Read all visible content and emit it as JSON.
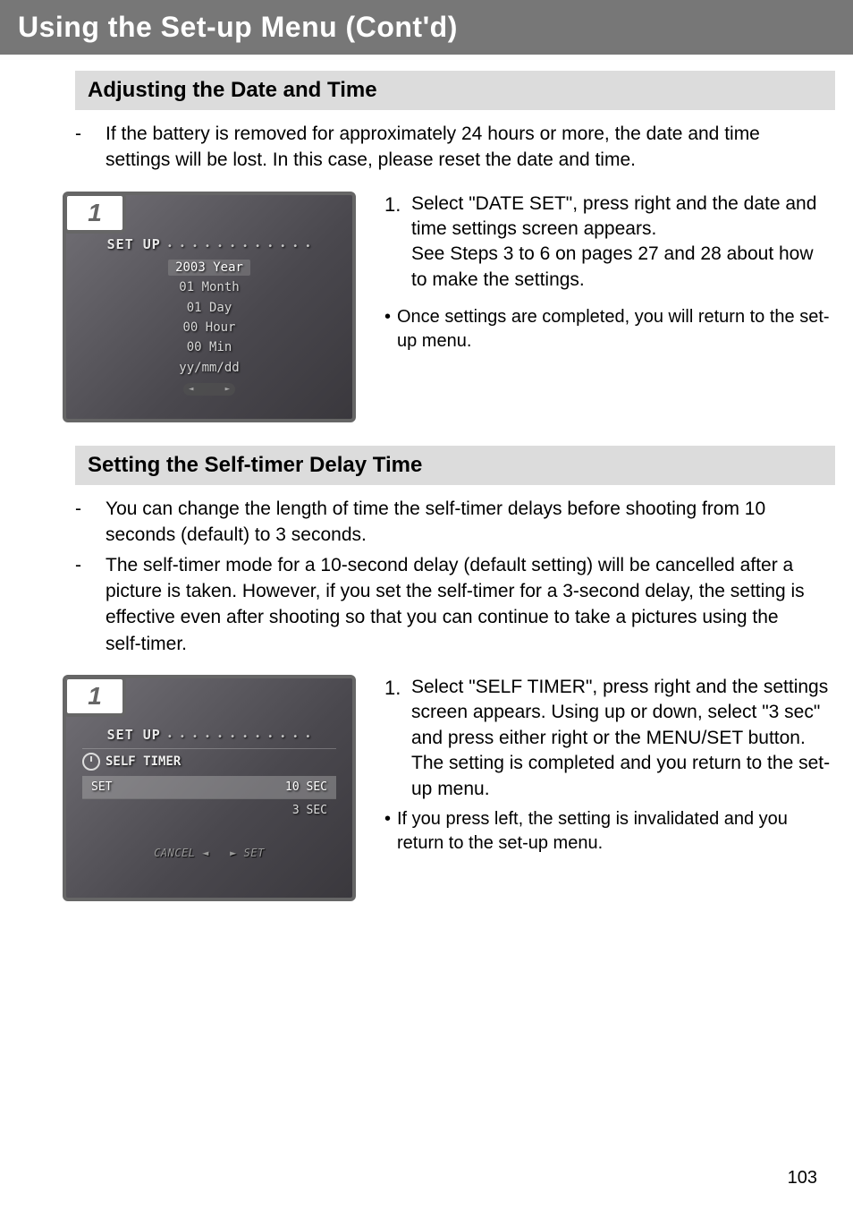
{
  "page_title": "Using the Set-up Menu (Cont'd)",
  "page_number": "103",
  "section1": {
    "heading": "Adjusting the Date and Time",
    "bullets": [
      "If the battery is removed for approximately 24 hours or more, the date and time settings will be lost.  In this case, please reset the date and time."
    ],
    "screenshot": {
      "badge": "1",
      "title": "SET UP",
      "items": [
        "2003 Year",
        "01 Month",
        "01 Day",
        "00 Hour",
        "00 Min",
        "yy/mm/dd"
      ]
    },
    "step": {
      "num": "1.",
      "text1": "Select \"DATE SET\", press right and the date and time settings screen appears.",
      "text2": "See Steps 3 to 6 on pages 27 and 28 about how to make the settings."
    },
    "sub_bullet": "Once settings are completed, you will return to the set-up menu."
  },
  "section2": {
    "heading": "Setting the Self-timer Delay Time",
    "bullets": [
      "You can change the length of time the self-timer delays before shooting from 10 seconds (default) to 3 seconds.",
      "The self-timer mode for a 10-second delay (default setting) will be cancelled after a picture is taken. However, if you set the self-timer for a 3-second delay, the setting is effective even after shooting so that you can continue to take a pictures using the self-timer."
    ],
    "screenshot": {
      "badge": "1",
      "title": "SET UP",
      "subtitle": "SELF TIMER",
      "row_label": "SET",
      "options": [
        "10 SEC",
        "3 SEC"
      ],
      "footer_left": "CANCEL ◄",
      "footer_right": "► SET"
    },
    "step": {
      "num": "1.",
      "text": "Select \"SELF TIMER\", press right and the settings screen appears. Using up or down, select \"3 sec\" and press either right or the MENU/SET button. The setting is completed and you return to the set-up menu."
    },
    "sub_bullet": "If you press left, the setting is invalidated and you return to the set-up menu."
  }
}
